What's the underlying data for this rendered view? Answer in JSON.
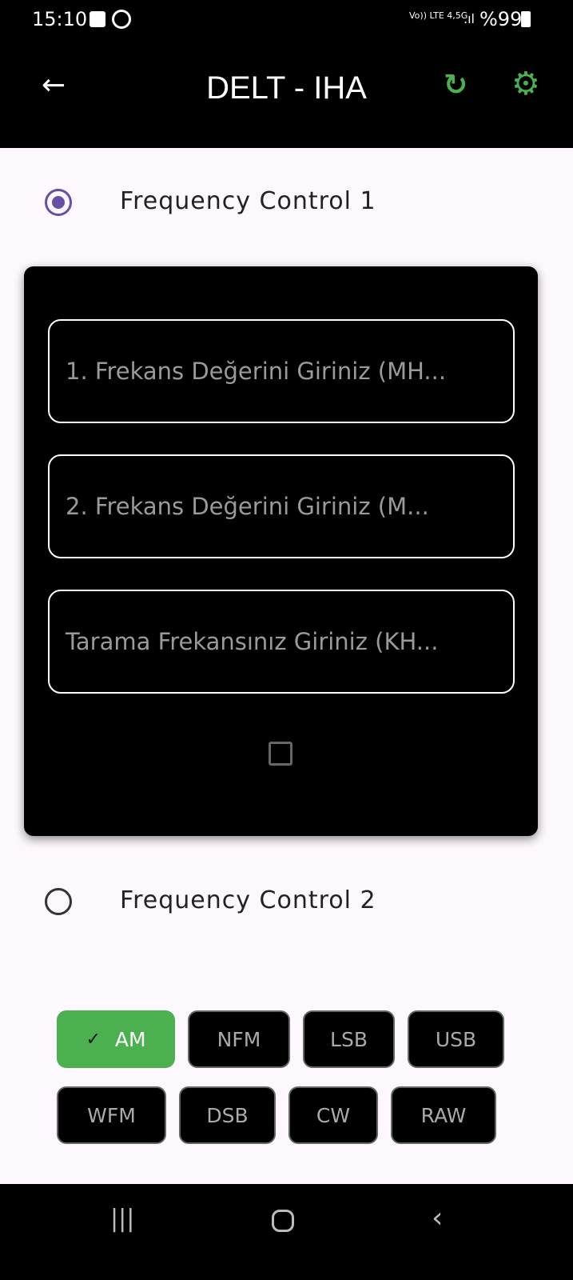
{
  "status": {
    "time": "15:10",
    "network": "Vo)) LTE 4,5G",
    "battery": "%99"
  },
  "appbar": {
    "title": "DELT - IHA",
    "accent": "#4caf50"
  },
  "radio1": {
    "label": "Frequency Control 1",
    "selected": true
  },
  "card": {
    "fields": [
      {
        "placeholder": "1. Frekans Değerini Giriniz (MH..."
      },
      {
        "placeholder": "2. Frekans Değerini Giriniz (M..."
      },
      {
        "placeholder": "Tarama Frekansınız Giriniz (KH..."
      }
    ],
    "checkbox_checked": false
  },
  "radio2": {
    "label": "Frequency Control 2",
    "selected": false
  },
  "modes": {
    "selected": "AM",
    "row1": [
      "AM",
      "NFM",
      "LSB",
      "USB"
    ],
    "row2": [
      "WFM",
      "DSB",
      "CW",
      "RAW"
    ]
  }
}
